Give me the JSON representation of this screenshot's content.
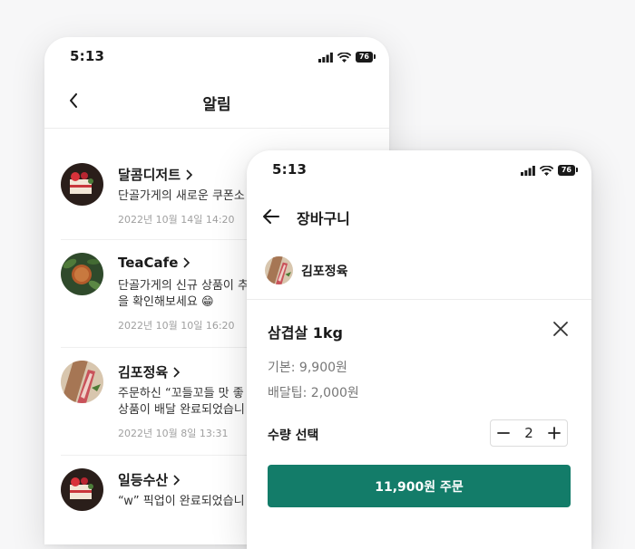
{
  "notifications_screen": {
    "status_time": "5:13",
    "battery": "76",
    "title": "알림",
    "items": [
      {
        "store": "달콤디저트",
        "message": "단골가게의 새로운 쿠폰소",
        "date": "2022년 10월 14일 14:20"
      },
      {
        "store": "TeaCafe",
        "message": "단골가게의 신규 상품이 추\n을 확인해보세요 😁",
        "date": "2022년 10월 10일 16:20"
      },
      {
        "store": "김포정육",
        "message": "주문하신 “꼬들꼬들 맛 좋\n상품이 배달 완료되었습니",
        "date": "2022년 10월 8일 13:31"
      },
      {
        "store": "일등수산",
        "message": "“w” 픽업이 완료되었습니",
        "date": ""
      }
    ]
  },
  "cart_screen": {
    "status_time": "5:13",
    "battery": "76",
    "title": "장바구니",
    "shop_name": "김포정육",
    "product_name": "삼겹살 1kg",
    "base_price": "기본: 9,900원",
    "delivery_tip": "배달팁: 2,000원",
    "quantity_label": "수량 선택",
    "quantity": "2",
    "order_button": "11,900원 주문"
  },
  "colors": {
    "accent": "#137c69",
    "background": "#f7f7f8"
  }
}
